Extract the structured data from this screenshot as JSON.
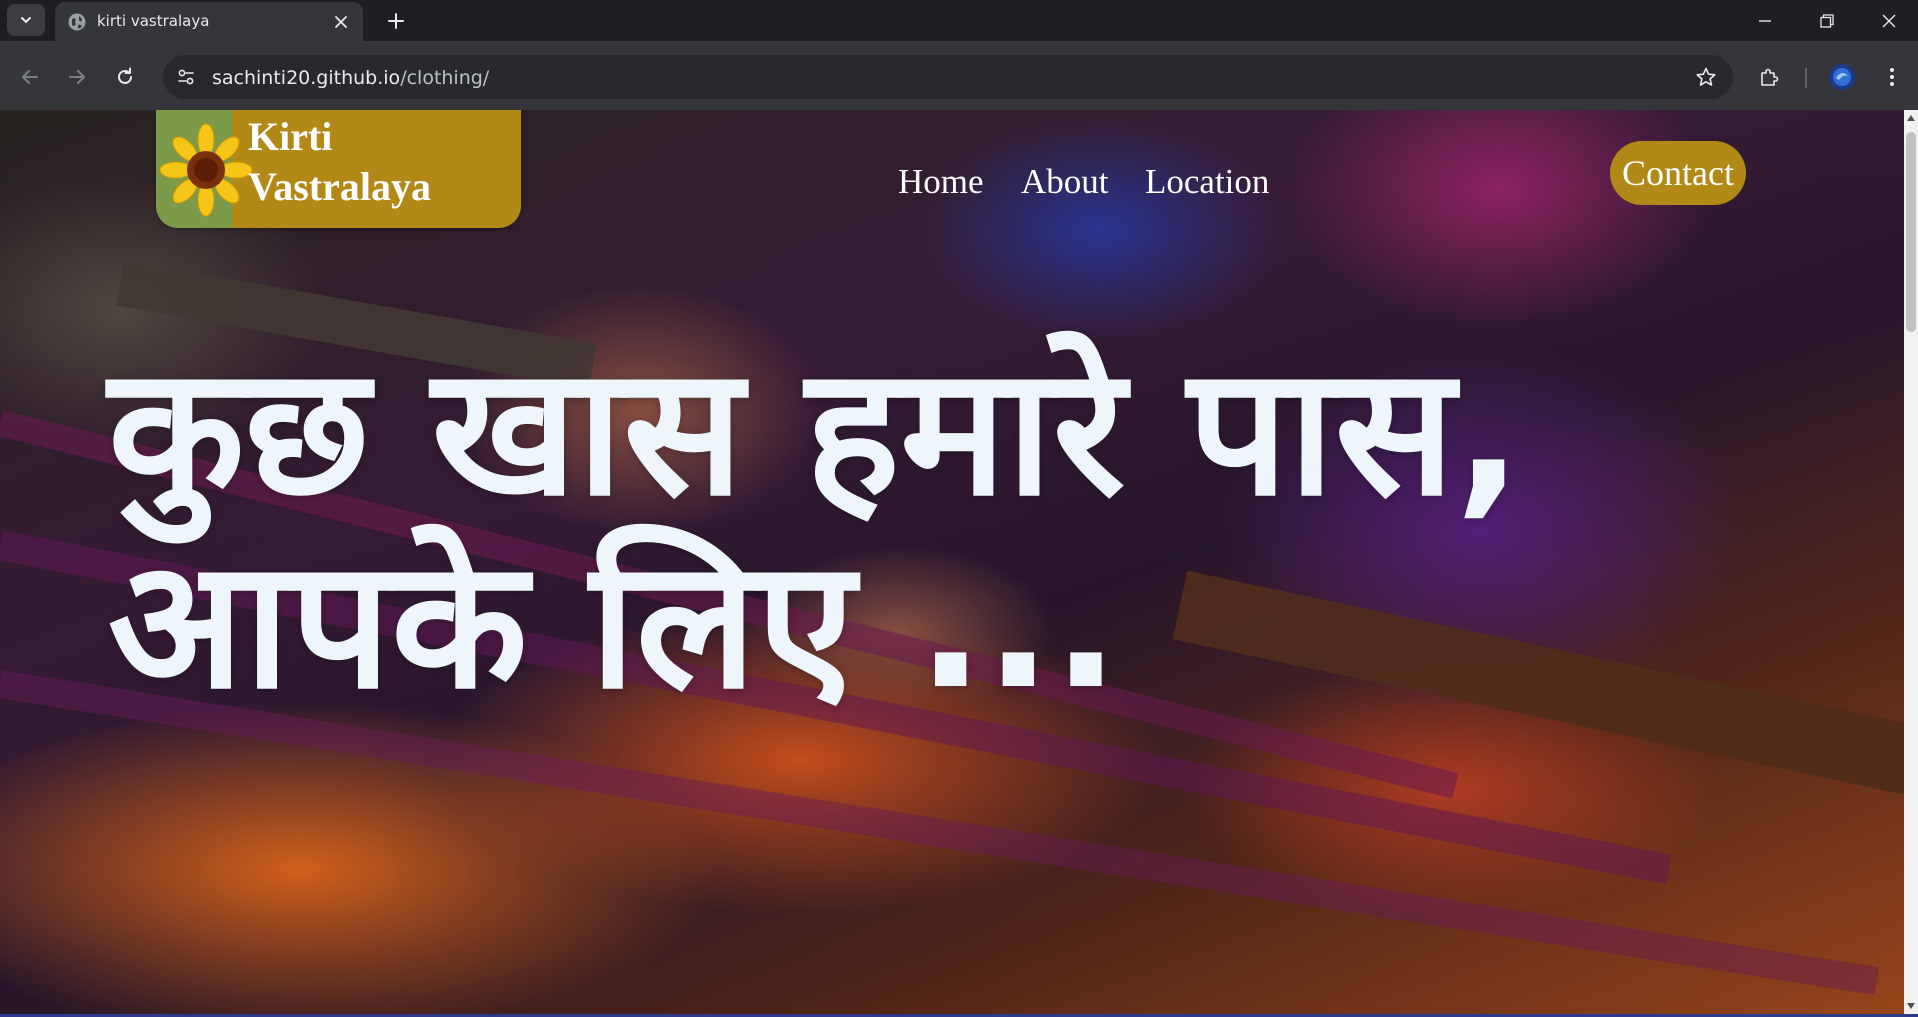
{
  "browser": {
    "tab": {
      "title": "kirti vastralaya"
    },
    "address": {
      "domain": "sachinti20.github.io",
      "path": "/clothing/"
    }
  },
  "site": {
    "brand": {
      "name": "Kirti Vastralaya",
      "accent": "#b28917"
    },
    "nav": {
      "home": "Home",
      "about": "About",
      "location": "Location"
    },
    "contact_label": "Contact",
    "hero": {
      "line1": "कुछ खास हमारे पास,",
      "line2": "आपके लिए ..."
    }
  },
  "icons": {
    "tab_search": "chevron-down-icon",
    "favicon": "globe-icon",
    "logo": "sunflower-icon"
  }
}
